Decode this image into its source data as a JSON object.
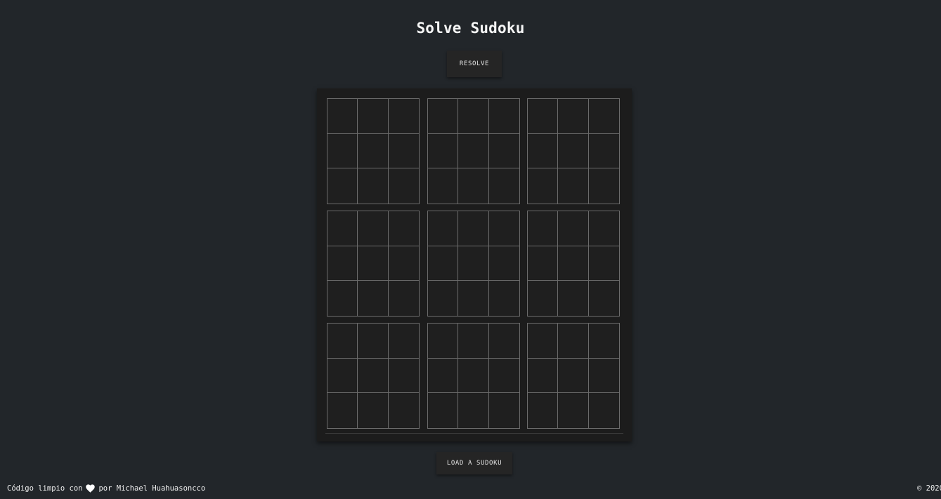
{
  "header": {
    "title": "Solve Sudoku"
  },
  "actions": {
    "resolve_label": "RESOLVE",
    "load_label": "LOAD A SUDOKU"
  },
  "board": {
    "rows": [
      [
        "",
        "",
        "",
        "",
        "",
        "",
        "",
        "",
        ""
      ],
      [
        "",
        "",
        "",
        "",
        "",
        "",
        "",
        "",
        ""
      ],
      [
        "",
        "",
        "",
        "",
        "",
        "",
        "",
        "",
        ""
      ],
      [
        "",
        "",
        "",
        "",
        "",
        "",
        "",
        "",
        ""
      ],
      [
        "",
        "",
        "",
        "",
        "",
        "",
        "",
        "",
        ""
      ],
      [
        "",
        "",
        "",
        "",
        "",
        "",
        "",
        "",
        ""
      ],
      [
        "",
        "",
        "",
        "",
        "",
        "",
        "",
        "",
        ""
      ],
      [
        "",
        "",
        "",
        "",
        "",
        "",
        "",
        "",
        ""
      ],
      [
        "",
        "",
        "",
        "",
        "",
        "",
        "",
        "",
        ""
      ]
    ]
  },
  "footer": {
    "credit_prefix": "Código limpio con",
    "heart_icon": "heart-icon",
    "credit_suffix": "por Michael Huahuasoncco",
    "copyright": "© 2020"
  },
  "colors": {
    "background": "#22262a",
    "board": "#1c1c1c",
    "grid_line": "#6b6b6b",
    "button": "#252525"
  }
}
